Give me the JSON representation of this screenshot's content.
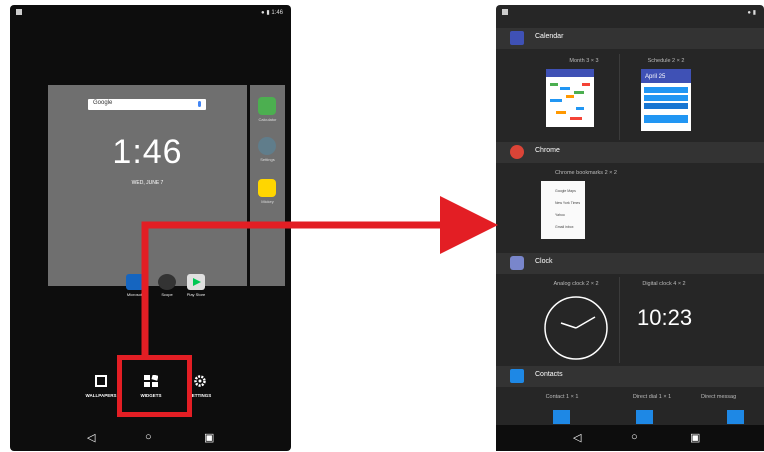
{
  "left": {
    "search_label": "Google",
    "clock": "1:46",
    "date": "WED, JUNE 7",
    "dock_apps": [
      {
        "label": "Microsoft",
        "color": "#1565c0"
      },
      {
        "label": "Scope",
        "color": "#333333"
      },
      {
        "label": "Play Store",
        "color": "#e0e0e0"
      }
    ],
    "right_apps": [
      {
        "label": "Calculator",
        "color": "#4caf50"
      },
      {
        "label": "Settings",
        "color": "#607d8b"
      },
      {
        "label": "Mickey",
        "color": "#ffd600"
      }
    ],
    "bottom_buttons": [
      {
        "label": "WALLPAPERS",
        "icon": "wallpaper-icon"
      },
      {
        "label": "WIDGETS",
        "icon": "widgets-icon"
      },
      {
        "label": "SETTINGS",
        "icon": "settings-gear-icon"
      }
    ],
    "nav": {
      "back": "◁",
      "home": "○",
      "recents": "▣"
    },
    "status_time": "1:46"
  },
  "right": {
    "sections": [
      {
        "title": "Calendar",
        "icon": "calendar-icon",
        "color": "#3f51b5",
        "widgets": [
          "Month 3 × 3",
          "Schedule 2 × 2"
        ]
      },
      {
        "title": "Chrome",
        "icon": "chrome-icon",
        "color": "#db4437",
        "widgets": [
          "Chrome bookmarks 2 × 2"
        ]
      },
      {
        "title": "Clock",
        "icon": "clock-icon",
        "color": "#7986cb",
        "widgets": [
          "Analog clock 2 × 2",
          "Digital clock 4 × 2"
        ]
      },
      {
        "title": "Contacts",
        "icon": "contacts-icon",
        "color": "#1e88e5",
        "widgets": [
          "Contact 1 × 1",
          "Direct dial 1 × 1",
          "Direct messag"
        ]
      }
    ],
    "schedule_date": "April 25",
    "bookmarks": [
      "Google Maps",
      "New York Times",
      "Yahoo",
      "Gmail inbox"
    ],
    "digital_clock": "10:23",
    "nav": {
      "back": "◁",
      "home": "○",
      "recents": "▣"
    }
  },
  "colors": {
    "arrow": "#e31e24",
    "highlight": "#e31e24"
  }
}
